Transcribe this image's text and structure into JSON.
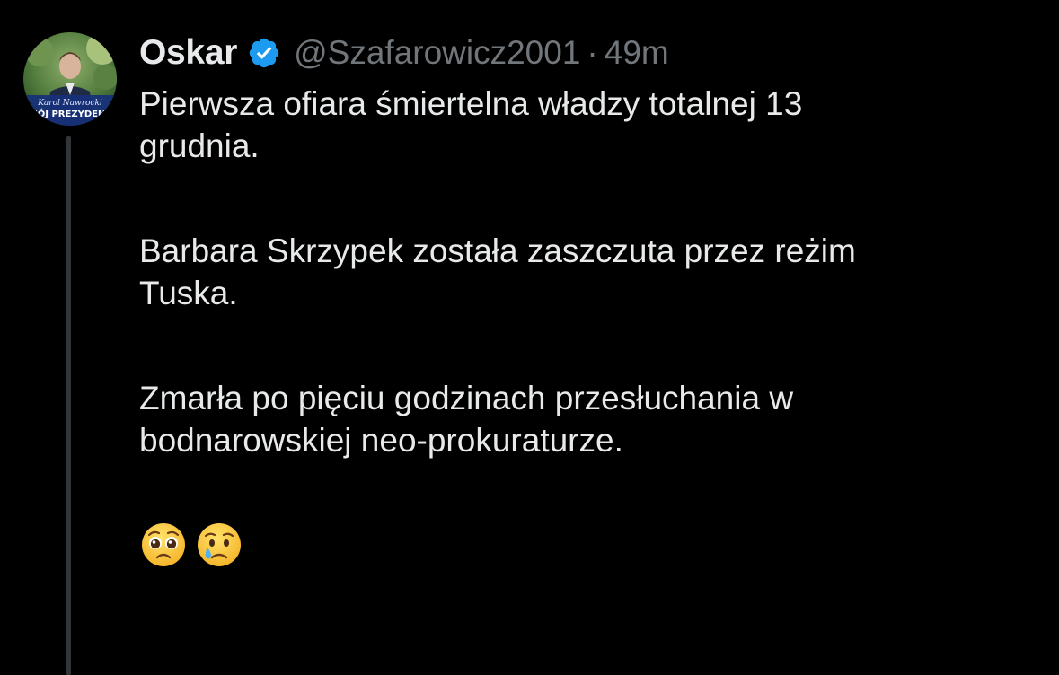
{
  "tweet": {
    "author": {
      "display_name": "Oskar",
      "handle": "@Szafarowicz2001",
      "verified": true,
      "avatar_banner_text": "MÓJ PREZYDENT",
      "avatar_signature_text": "Karol Nawrocki"
    },
    "separator": "·",
    "time": "49m",
    "paragraphs": [
      [
        "Pierwsza ofiara śmiertelna władzy totalnej 13",
        "grudnia."
      ],
      [
        "Barbara Skrzypek została zaszczuta przez reżim",
        "Tuska."
      ],
      [
        "Zmarła po pięciu godzinach przesłuchania w",
        "bodnarowskiej neo-prokuraturze."
      ]
    ],
    "emojis": [
      "pleading-face-icon",
      "crying-face-icon"
    ]
  },
  "colors": {
    "background": "#000000",
    "primary_text": "#e7e9ea",
    "secondary_text": "#71767b",
    "verified_badge": "#1d9bf0",
    "thread_line": "#333639"
  }
}
